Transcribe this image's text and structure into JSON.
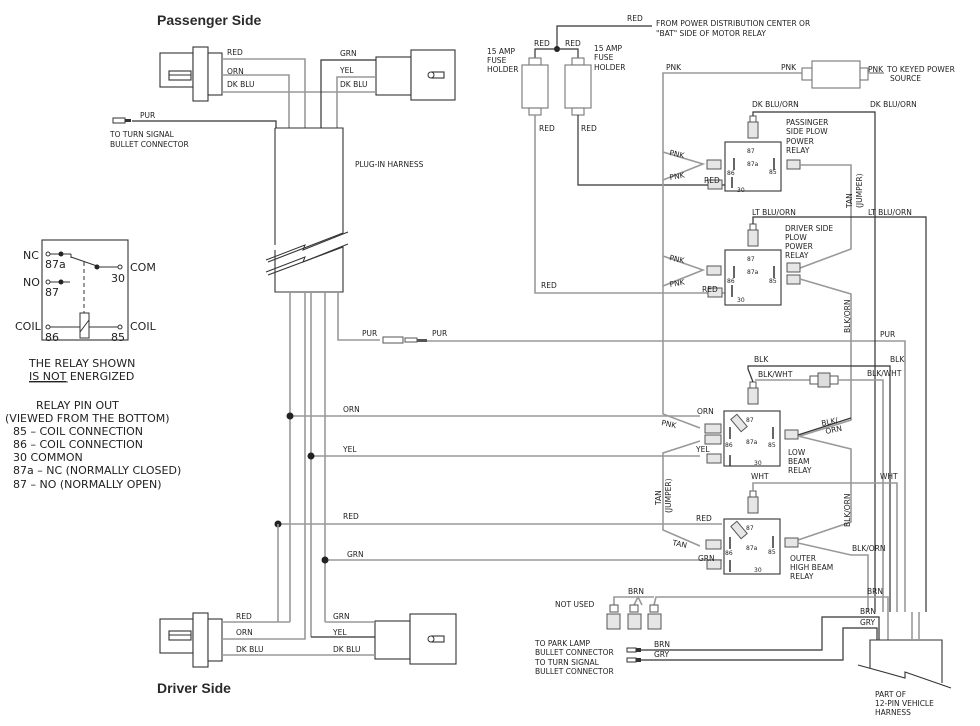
{
  "titles": {
    "passenger_side": "Passenger Side",
    "driver_side": "Driver Side"
  },
  "headlamp_connectors": {
    "passenger": {
      "wires_left": [
        "RED",
        "ORN",
        "DK BLU"
      ],
      "wires_right": [
        "GRN",
        "YEL",
        "DK BLU"
      ]
    },
    "driver": {
      "wires_left": [
        "RED",
        "ORN",
        "DK BLU"
      ],
      "wires_right": [
        "GRN",
        "YEL",
        "DK BLU"
      ]
    }
  },
  "turn_signal_top": {
    "wire": "PUR",
    "label_line1": "TO TURN SIGNAL",
    "label_line2": "BULLET CONNECTOR"
  },
  "plug_in_harness": {
    "label": "PLUG-IN HARNESS",
    "pur_left": "PUR",
    "pur_right": "PUR"
  },
  "relay_legend": {
    "nc": "NC",
    "no": "NO",
    "com": "COM",
    "coil_left": "COIL",
    "coil_right": "COIL",
    "pin_87a": "87a",
    "pin_87": "87",
    "pin_30": "30",
    "pin_86": "86",
    "pin_85": "85",
    "note_line1": "THE RELAY SHOWN",
    "note_underlined": "IS NOT",
    "note_line2_rest": " ENERGIZED"
  },
  "pinout": {
    "title": "RELAY PIN   OUT",
    "subtitle": "(VIEWED FROM THE BOTTOM)",
    "lines": [
      "85  –  COIL CONNECTION",
      "86  –  COIL CONNECTION",
      "30  COMMON",
      "87a  –  NC (NORMALLY CLOSED)",
      "87  –  NO (NORMALLY OPEN)"
    ]
  },
  "power": {
    "red_main": "RED",
    "source_line1": "FROM POWER DISTRIBUTION CENTER OR",
    "source_line2": "\"BAT\" SIDE OF MOTOR RELAY",
    "fuse_left": [
      "15 AMP",
      "FUSE",
      "HOLDER"
    ],
    "fuse_right": [
      "15 AMP",
      "FUSE",
      "HOLDER"
    ],
    "red_top_left": "RED",
    "red_top_right": "RED",
    "red_below_left": "RED",
    "red_below_right": "RED",
    "red_to_driver_relay": "RED"
  },
  "keyed": {
    "pnk_left": "PNK",
    "pnk_mid": "PNK",
    "pnk_right": "PNK",
    "label_line1": "TO KEYED POWER",
    "label_line2": "SOURCE"
  },
  "relays": [
    {
      "id": "passenger-plow",
      "name_lines": [
        "PASSINGER",
        "SIDE PLOW",
        "POWER",
        "RELAY"
      ],
      "top_wire": "DK BLU/ORN",
      "right_wire": "DK BLU/ORN",
      "pins": [
        "87",
        "87a",
        "86",
        "85",
        "30"
      ],
      "in_wires": [
        "PNK",
        "PNK",
        "RED"
      ]
    },
    {
      "id": "driver-plow",
      "name_lines": [
        "DRIVER SIDE",
        "PLOW",
        "POWER",
        "RELAY"
      ],
      "top_wire": "LT BLU/ORN",
      "right_wire": "LT BLU/ORN",
      "pins": [
        "87",
        "87a",
        "86",
        "85",
        "30"
      ],
      "in_wires": [
        "PNK",
        "PNK",
        "RED"
      ]
    },
    {
      "id": "low-beam",
      "name_lines": [
        "LOW",
        "BEAM",
        "RELAY"
      ],
      "top_wire": "BLK/WHT",
      "pins": [
        "87",
        "87a",
        "86",
        "85",
        "30"
      ],
      "in_wires": [
        "ORN",
        "PNK",
        "YEL"
      ]
    },
    {
      "id": "outer-high-beam",
      "name_lines": [
        "OUTER",
        "HIGH BEAM",
        "RELAY"
      ],
      "top_wire": "WHT",
      "pins": [
        "87",
        "87a",
        "86",
        "85",
        "30"
      ],
      "in_wires": [
        "RED",
        "TAN",
        "GRN"
      ]
    }
  ],
  "jumpers": {
    "tan_upper": "TAN",
    "tan_upper_note": "(JUMPER)",
    "tan_lower": "TAN",
    "tan_lower_note": "(JUMPER)",
    "tan_short": "TAN"
  },
  "bus_labels": {
    "orn": "ORN",
    "yel": "YEL",
    "red": "RED",
    "grn": "GRN",
    "pur_right": "PUR",
    "blk_top": "BLK",
    "blk_right": "BLK",
    "blk_wht_right": "BLK/WHT",
    "blk_orn_vert1": "BLK/ORN",
    "blk_orn_diag": "BLK/",
    "blk_orn_diag2": "ORN",
    "blk_orn_vert2": "BLK/ORN",
    "blk_orn_right": "BLK/ORN",
    "wht_right": "WHT"
  },
  "bottom_right": {
    "not_used": "NOT USED",
    "brn_top": "BRN",
    "brn_right": "BRN",
    "brn2": "BRN",
    "gry2": "GRY",
    "park_line1": "TO PARK LAMP",
    "park_line2": "BULLET CONNECTOR",
    "turn_line1": "TO TURN SIGNAL",
    "turn_line2": "BULLET CONNECTOR",
    "brn_bullet": "BRN",
    "gry_bullet": "GRY",
    "harness_line1": "PART OF",
    "harness_line2": "12-PIN VEHICLE",
    "harness_line3": "HARNESS"
  }
}
